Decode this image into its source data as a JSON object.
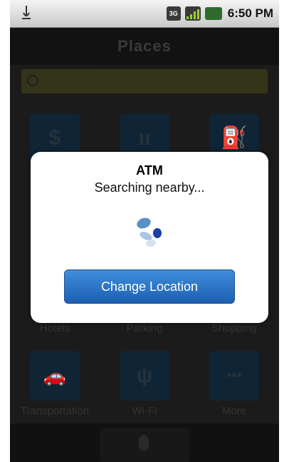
{
  "status_bar": {
    "time": "6:50 PM",
    "network_label": "3G",
    "icons": [
      "usb-icon",
      "3g-icon",
      "signal-icon",
      "battery-icon"
    ]
  },
  "app": {
    "title": "Places",
    "categories": [
      {
        "label": "",
        "icon": "dollar-icon",
        "glyph": "$"
      },
      {
        "label": "",
        "icon": "restaurant-icon",
        "glyph": "ıı"
      },
      {
        "label": "",
        "icon": "gas-station-icon",
        "glyph": "⛽"
      },
      {
        "label": "Hotels",
        "icon": "hotel-icon",
        "glyph": ""
      },
      {
        "label": "Parking",
        "icon": "parking-icon",
        "glyph": ""
      },
      {
        "label": "Shopping",
        "icon": "shopping-icon",
        "glyph": ""
      },
      {
        "label": "Transportation",
        "icon": "car-icon",
        "glyph": "🚗"
      },
      {
        "label": "Wi-Fi",
        "icon": "wifi-icon",
        "glyph": "ψ"
      },
      {
        "label": "More",
        "icon": "more-icon",
        "glyph": "•••"
      }
    ]
  },
  "dialog": {
    "title": "ATM",
    "message": "Searching nearby...",
    "button_label": "Change Location"
  },
  "colors": {
    "button_top": "#3f8fdc",
    "button_bottom": "#1d5fb0",
    "dimmed_tile": "#0f2535"
  }
}
